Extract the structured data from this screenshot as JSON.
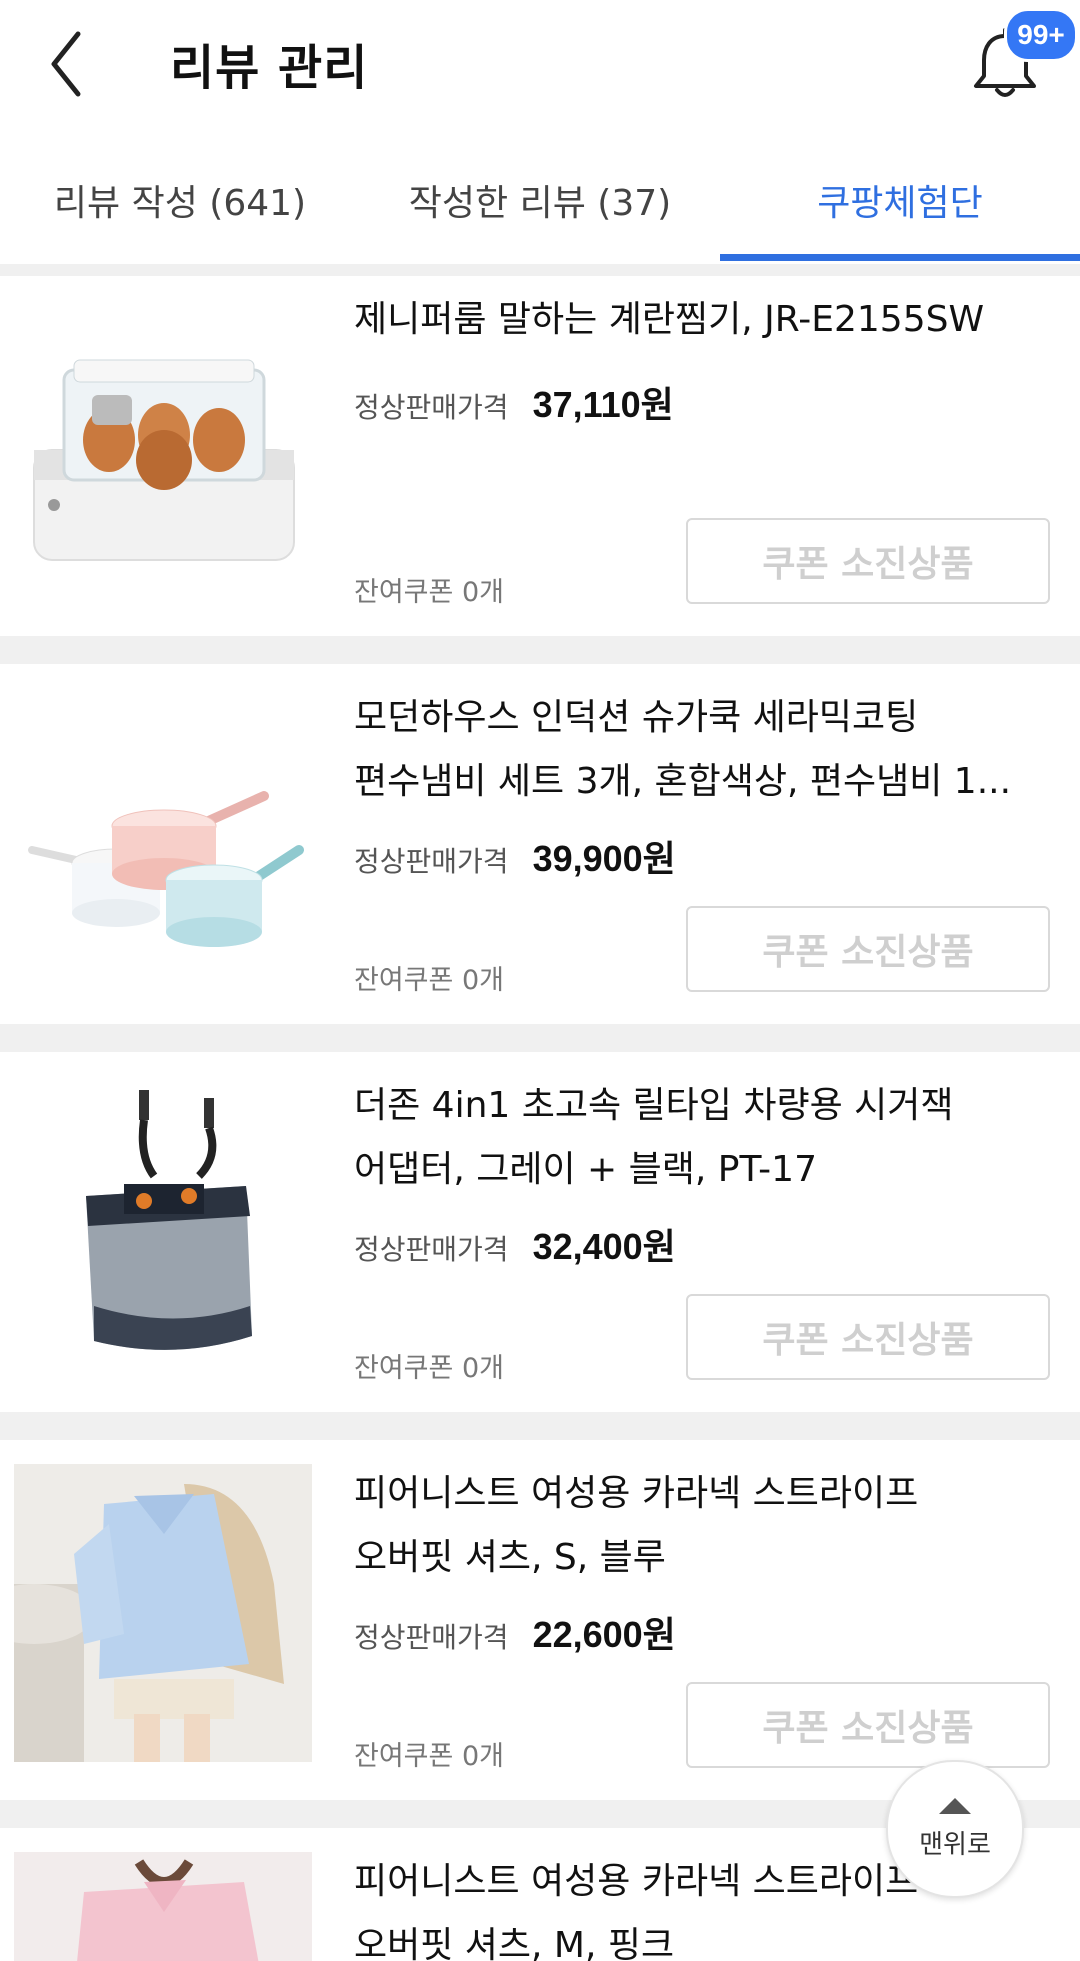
{
  "header": {
    "title": "리뷰 관리",
    "notification_badge": "99+"
  },
  "tabs": [
    {
      "label": "리뷰 작성 (641)",
      "active": false
    },
    {
      "label": "작성한 리뷰 (37)",
      "active": false
    },
    {
      "label": "쿠팡체험단",
      "active": true
    }
  ],
  "products": [
    {
      "name_line1": "제니퍼룸 말하는 계란찜기, JR-E2155SW",
      "name_line2": "",
      "price_label": "정상판매가격",
      "price": "37,110원",
      "coupon": "잔여쿠폰 0개",
      "button": "쿠폰 소진상품"
    },
    {
      "name_line1": "모던하우스 인덕션 슈가쿡 세라믹코팅",
      "name_line2": "편수냄비 세트 3개, 혼합색상, 편수냄비 1...",
      "price_label": "정상판매가격",
      "price": "39,900원",
      "coupon": "잔여쿠폰 0개",
      "button": "쿠폰 소진상품"
    },
    {
      "name_line1": "더존 4in1 초고속 릴타입 차량용 시거잭",
      "name_line2": "어댑터, 그레이 + 블랙, PT-17",
      "price_label": "정상판매가격",
      "price": "32,400원",
      "coupon": "잔여쿠폰 0개",
      "button": "쿠폰 소진상품"
    },
    {
      "name_line1": "피어니스트 여성용 카라넥 스트라이프",
      "name_line2": "오버핏 셔츠, S, 블루",
      "price_label": "정상판매가격",
      "price": "22,600원",
      "coupon": "잔여쿠폰 0개",
      "button": "쿠폰 소진상품"
    },
    {
      "name_line1": "피어니스트 여성용 카라넥 스트라이프",
      "name_line2": "오버핏 셔츠, M, 핑크"
    }
  ],
  "scroll_top_label": "맨위로",
  "colors": {
    "accent": "#2f6fe0",
    "badge": "#3477f5",
    "separator": "#f0f0f0",
    "disabled_text": "#cfcfcf"
  },
  "icons": {
    "back": "chevron-left-icon",
    "notification": "bell-icon",
    "scroll_top": "arrow-up-icon"
  }
}
